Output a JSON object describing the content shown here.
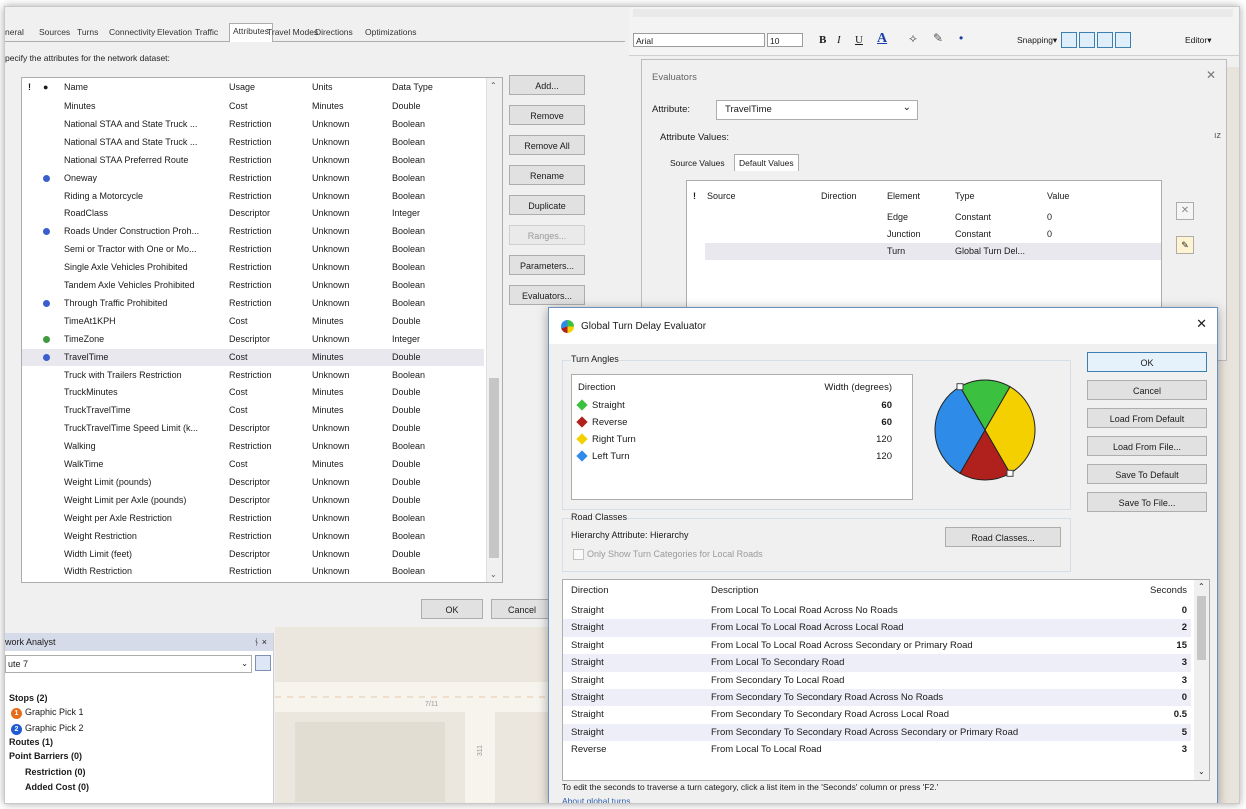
{
  "properties_dialog": {
    "tabs": [
      "neral",
      "Sources",
      "Turns",
      "Connectivity",
      "Elevation",
      "Traffic",
      "Attributes",
      "Travel Modes",
      "Directions",
      "Optimizations"
    ],
    "active_tab": "Attributes",
    "instruction": "pecify the attributes for the network dataset:",
    "columns": {
      "flag": "!",
      "icon": "●",
      "name": "Name",
      "usage": "Usage",
      "units": "Units",
      "data_type": "Data Type"
    },
    "attributes": [
      {
        "name": "Minutes",
        "usage": "Cost",
        "units": "Minutes",
        "type": "Double",
        "dot": ""
      },
      {
        "name": "National STAA and State Truck ...",
        "usage": "Restriction",
        "units": "Unknown",
        "type": "Boolean",
        "dot": ""
      },
      {
        "name": "National STAA and State Truck ...",
        "usage": "Restriction",
        "units": "Unknown",
        "type": "Boolean",
        "dot": ""
      },
      {
        "name": "National STAA Preferred Route",
        "usage": "Restriction",
        "units": "Unknown",
        "type": "Boolean",
        "dot": ""
      },
      {
        "name": "Oneway",
        "usage": "Restriction",
        "units": "Unknown",
        "type": "Boolean",
        "dot": "#3a5fcd"
      },
      {
        "name": "Riding a Motorcycle",
        "usage": "Restriction",
        "units": "Unknown",
        "type": "Boolean",
        "dot": ""
      },
      {
        "name": "RoadClass",
        "usage": "Descriptor",
        "units": "Unknown",
        "type": "Integer",
        "dot": ""
      },
      {
        "name": "Roads Under Construction Proh...",
        "usage": "Restriction",
        "units": "Unknown",
        "type": "Boolean",
        "dot": "#3a5fcd"
      },
      {
        "name": "Semi or Tractor with One or Mo...",
        "usage": "Restriction",
        "units": "Unknown",
        "type": "Boolean",
        "dot": ""
      },
      {
        "name": "Single Axle Vehicles Prohibited",
        "usage": "Restriction",
        "units": "Unknown",
        "type": "Boolean",
        "dot": ""
      },
      {
        "name": "Tandem Axle Vehicles Prohibited",
        "usage": "Restriction",
        "units": "Unknown",
        "type": "Boolean",
        "dot": ""
      },
      {
        "name": "Through Traffic Prohibited",
        "usage": "Restriction",
        "units": "Unknown",
        "type": "Boolean",
        "dot": "#3a5fcd"
      },
      {
        "name": "TimeAt1KPH",
        "usage": "Cost",
        "units": "Minutes",
        "type": "Double",
        "dot": ""
      },
      {
        "name": "TimeZone",
        "usage": "Descriptor",
        "units": "Unknown",
        "type": "Integer",
        "dot": "#3f9a3f"
      },
      {
        "name": "TravelTime",
        "usage": "Cost",
        "units": "Minutes",
        "type": "Double",
        "dot": "#3a5fcd"
      },
      {
        "name": "Truck with Trailers Restriction",
        "usage": "Restriction",
        "units": "Unknown",
        "type": "Boolean",
        "dot": ""
      },
      {
        "name": "TruckMinutes",
        "usage": "Cost",
        "units": "Minutes",
        "type": "Double",
        "dot": ""
      },
      {
        "name": "TruckTravelTime",
        "usage": "Cost",
        "units": "Minutes",
        "type": "Double",
        "dot": ""
      },
      {
        "name": "TruckTravelTime Speed Limit (k...",
        "usage": "Descriptor",
        "units": "Unknown",
        "type": "Double",
        "dot": ""
      },
      {
        "name": "Walking",
        "usage": "Restriction",
        "units": "Unknown",
        "type": "Boolean",
        "dot": ""
      },
      {
        "name": "WalkTime",
        "usage": "Cost",
        "units": "Minutes",
        "type": "Double",
        "dot": ""
      },
      {
        "name": "Weight Limit (pounds)",
        "usage": "Descriptor",
        "units": "Unknown",
        "type": "Double",
        "dot": ""
      },
      {
        "name": "Weight Limit per Axle (pounds)",
        "usage": "Descriptor",
        "units": "Unknown",
        "type": "Double",
        "dot": ""
      },
      {
        "name": "Weight per Axle Restriction",
        "usage": "Restriction",
        "units": "Unknown",
        "type": "Boolean",
        "dot": ""
      },
      {
        "name": "Weight Restriction",
        "usage": "Restriction",
        "units": "Unknown",
        "type": "Boolean",
        "dot": ""
      },
      {
        "name": "Width Limit (feet)",
        "usage": "Descriptor",
        "units": "Unknown",
        "type": "Double",
        "dot": ""
      },
      {
        "name": "Width Restriction",
        "usage": "Restriction",
        "units": "Unknown",
        "type": "Boolean",
        "dot": ""
      }
    ],
    "selected_attribute": "TravelTime",
    "buttons": {
      "add": "Add...",
      "remove": "Remove",
      "remove_all": "Remove All",
      "rename": "Rename",
      "duplicate": "Duplicate",
      "ranges": "Ranges...",
      "parameters": "Parameters...",
      "evaluators": "Evaluators..."
    },
    "ok": "OK",
    "cancel": "Cancel"
  },
  "network_analyst": {
    "title": "work Analyst",
    "pin": "ᚾ ×",
    "route": "ute 7",
    "stops": "Stops (2)",
    "stop1_num": "1",
    "stop1": "Graphic Pick 1",
    "stop2_num": "2",
    "stop2": "Graphic Pick 2",
    "routes": "Routes (1)",
    "point_barriers": "Point Barriers (0)",
    "restriction": "Restriction (0)",
    "added_cost": "Added Cost (0)"
  },
  "map_labels": {
    "label1": "7/11",
    "label2": "311"
  },
  "toolbar": {
    "font": "Arial",
    "size": "10",
    "bold": "B",
    "italic": "I",
    "underline": "U",
    "snapping": "Snapping▾",
    "editor": "Editor▾"
  },
  "evaluators": {
    "title": "Evaluators",
    "attribute_label": "Attribute:",
    "attribute_value": "TravelTime",
    "values_label": "Attribute Values:",
    "tabs": [
      "Source Values",
      "Default Values"
    ],
    "columns": [
      "!",
      "Source",
      "Direction",
      "Element",
      "Type",
      "Value"
    ],
    "rows": [
      {
        "element": "Edge",
        "type": "Constant",
        "value": "0"
      },
      {
        "element": "Junction",
        "type": "Constant",
        "value": "0"
      },
      {
        "element": "Turn",
        "type": "Global Turn Del...",
        "value": ""
      }
    ],
    "side_text": "ız"
  },
  "gtd": {
    "title": "Global Turn Delay Evaluator",
    "turn_angles_label": "Turn Angles",
    "direction_header": "Direction",
    "width_header": "Width (degrees)",
    "angles": [
      {
        "name": "Straight",
        "width": "60",
        "bold": true,
        "color": "#3cc040"
      },
      {
        "name": "Reverse",
        "width": "60",
        "bold": true,
        "color": "#b0211d"
      },
      {
        "name": "Right Turn",
        "width": "120",
        "bold": false,
        "color": "#f5d000"
      },
      {
        "name": "Left Turn",
        "width": "120",
        "bold": false,
        "color": "#2e8be8"
      }
    ],
    "road_classes_label": "Road Classes",
    "hierarchy": "Hierarchy Attribute: Hierarchy",
    "road_classes_btn": "Road Classes...",
    "only_show": "Only Show Turn Categories for Local Roads",
    "buttons": {
      "ok": "OK",
      "cancel": "Cancel",
      "load_default": "Load From Default",
      "load_file": "Load From File...",
      "save_default": "Save To Default",
      "save_file": "Save To File..."
    },
    "table_headers": {
      "direction": "Direction",
      "description": "Description",
      "seconds": "Seconds"
    },
    "turn_rows": [
      {
        "direction": "Straight",
        "description": "From Local To Local Road Across No Roads",
        "seconds": "0"
      },
      {
        "direction": "Straight",
        "description": "From Local To Local Road Across Local Road",
        "seconds": "2"
      },
      {
        "direction": "Straight",
        "description": "From Local To Local Road Across Secondary or Primary Road",
        "seconds": "15"
      },
      {
        "direction": "Straight",
        "description": "From Local To Secondary Road",
        "seconds": "3"
      },
      {
        "direction": "Straight",
        "description": "From Secondary To Local Road",
        "seconds": "3"
      },
      {
        "direction": "Straight",
        "description": "From Secondary To Secondary Road Across No Roads",
        "seconds": "0"
      },
      {
        "direction": "Straight",
        "description": "From Secondary To Secondary Road Across Local Road",
        "seconds": "0.5"
      },
      {
        "direction": "Straight",
        "description": "From Secondary To Secondary Road Across Secondary or Primary Road",
        "seconds": "5"
      },
      {
        "direction": "Reverse",
        "description": "From Local To Local Road",
        "seconds": "3"
      }
    ],
    "hint": "To edit the seconds to traverse a turn category, click a list item in the 'Seconds' column or press 'F2.'",
    "about": "About global turns"
  }
}
